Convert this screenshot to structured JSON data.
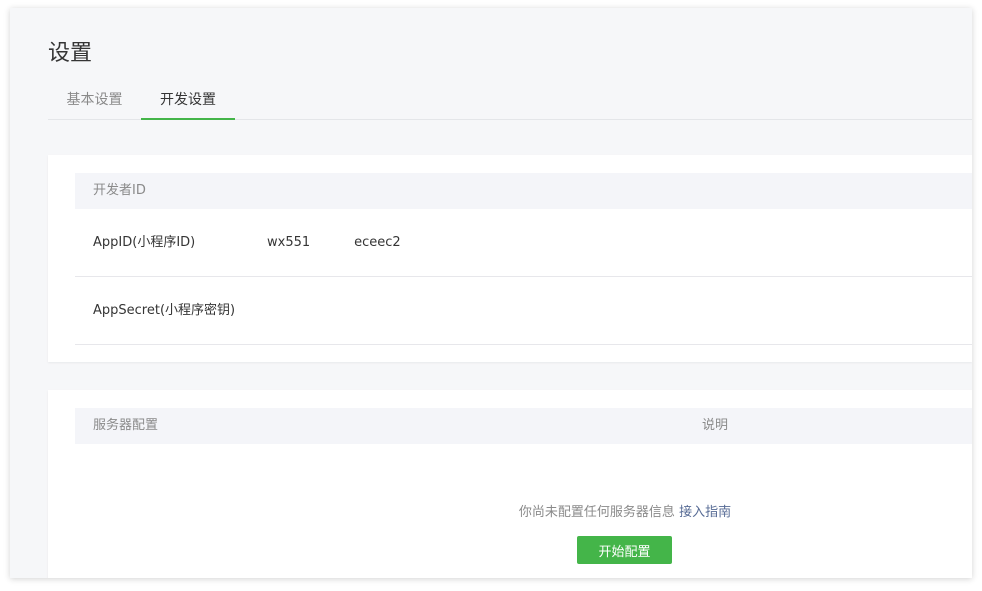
{
  "page": {
    "title": "设置"
  },
  "tabs": [
    {
      "label": "基本设置",
      "active": false
    },
    {
      "label": "开发设置",
      "active": true
    }
  ],
  "developer_id": {
    "header": "开发者ID",
    "rows": [
      {
        "label": "AppID(小程序ID)",
        "value_start": "wx551",
        "value_end": "eceec2"
      },
      {
        "label": "AppSecret(小程序密钥)",
        "value": ""
      }
    ]
  },
  "server_config": {
    "header": "服务器配置",
    "desc_header": "说明",
    "empty_text": "你尚未配置任何服务器信息",
    "guide_link": "接入指南",
    "start_button": "开始配置"
  },
  "colors": {
    "accent": "#44b549",
    "link": "#576b95",
    "text_primary": "#353535",
    "text_secondary": "#8a8a8a"
  }
}
